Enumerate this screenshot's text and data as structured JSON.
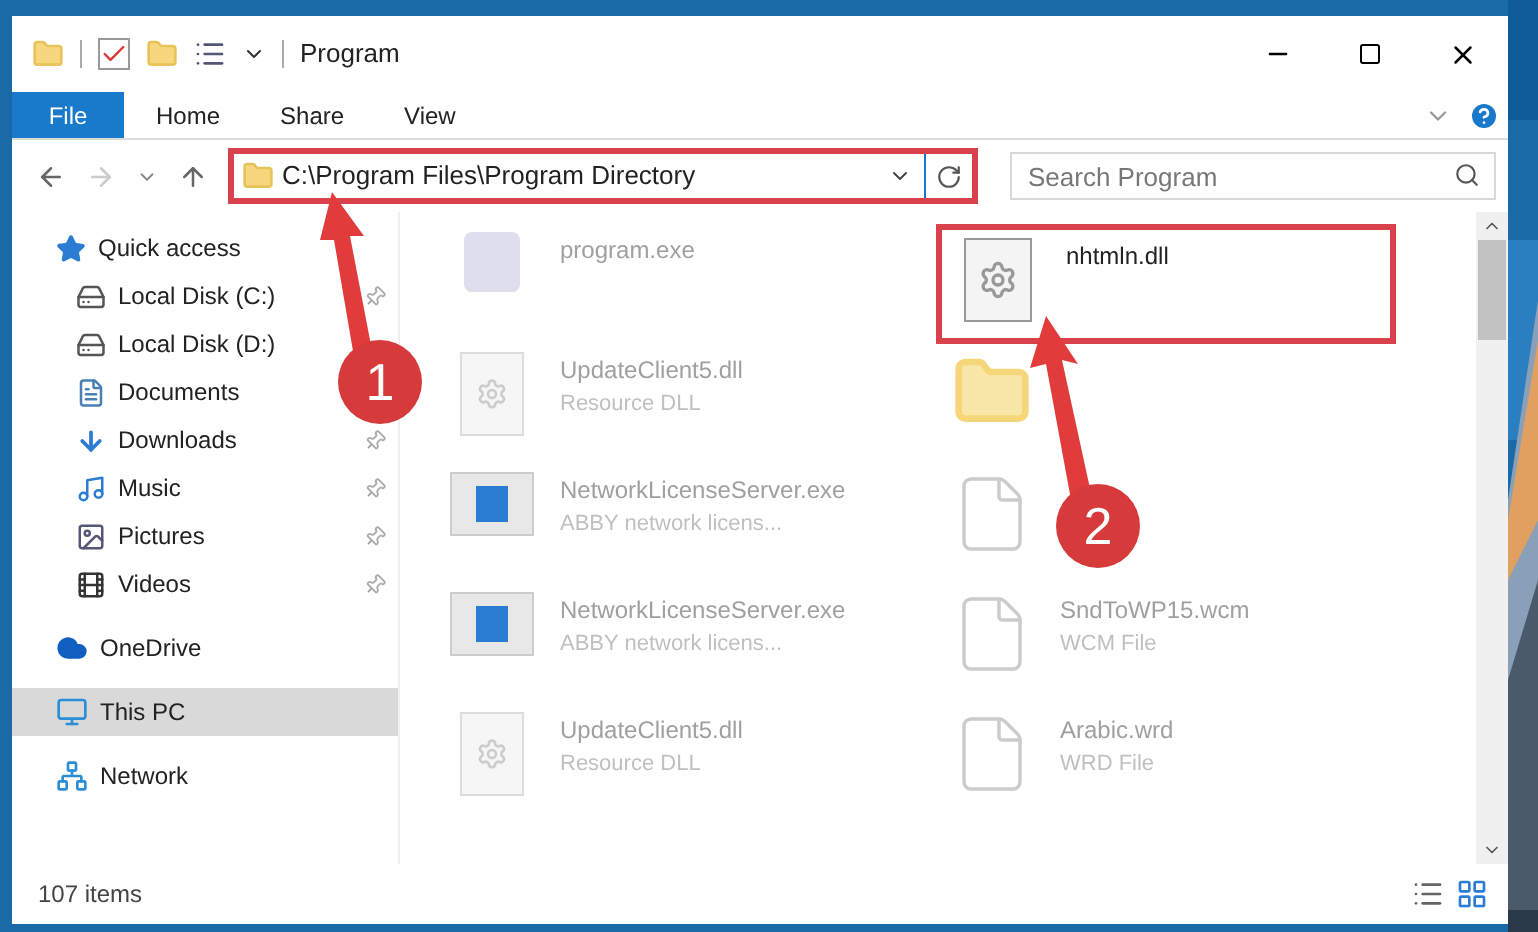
{
  "window": {
    "title": "Program"
  },
  "ribbon_tabs": [
    {
      "label": "File",
      "kind": "file-menu"
    },
    {
      "label": "Home",
      "kind": "tab"
    },
    {
      "label": "Share",
      "kind": "tab"
    },
    {
      "label": "View",
      "kind": "tab"
    }
  ],
  "address_bar": {
    "path": "C:\\Program Files\\Program Directory",
    "highlighted": true
  },
  "search": {
    "placeholder": "Search Program"
  },
  "sidebar": {
    "items": [
      {
        "label": "Quick access",
        "kind": "star",
        "selected": false,
        "children": [
          {
            "label": "Local Disk (C:)",
            "kind": "system-drive",
            "pinned": true
          },
          {
            "label": "Local Disk (D:)",
            "kind": "drive"
          },
          {
            "label": "Documents",
            "kind": "document"
          },
          {
            "label": "Downloads",
            "kind": "download",
            "pinned": true
          },
          {
            "label": "Music",
            "kind": "music",
            "pinned": true
          },
          {
            "label": "Pictures",
            "kind": "pictures",
            "pinned": true
          },
          {
            "label": "Videos",
            "kind": "video",
            "pinned": true
          }
        ]
      },
      {
        "label": "OneDrive",
        "kind": "cloud",
        "selected": false
      },
      {
        "label": "This PC",
        "kind": "computer",
        "selected": true
      },
      {
        "label": "Network",
        "kind": "network",
        "selected": false
      }
    ]
  },
  "files": [
    {
      "name": "program.exe",
      "kind": "installer",
      "highlighted": false
    },
    {
      "name": "nhtmln.dll",
      "kind": "settings-file",
      "highlighted": true
    },
    {
      "name": "UpdateClient5.dll",
      "type": "Resource DLL",
      "kind": "dll",
      "highlighted": false
    },
    {
      "kind": "folder"
    },
    {
      "name": "NetworkLicenseServer.exe",
      "type": "ABBY network licens...",
      "kind": "app",
      "highlighted": false
    },
    {
      "kind": "blank"
    },
    {
      "name": "NetworkLicenseServer.exe",
      "type": "ABBY network licens...",
      "kind": "app",
      "highlighted": false
    },
    {
      "name": "SndToWP15.wcm",
      "type": "WCM File",
      "kind": "blank",
      "highlighted": false
    },
    {
      "name": "UpdateClient5.dll",
      "type": "Resource DLL",
      "kind": "dll",
      "highlighted": false
    },
    {
      "name": "Arabic.wrd",
      "type": "WRD File",
      "kind": "blank",
      "highlighted": false
    }
  ],
  "callouts": [
    {
      "number": "1"
    },
    {
      "number": "2"
    }
  ],
  "status_bar": {
    "item_count": "107 items"
  }
}
